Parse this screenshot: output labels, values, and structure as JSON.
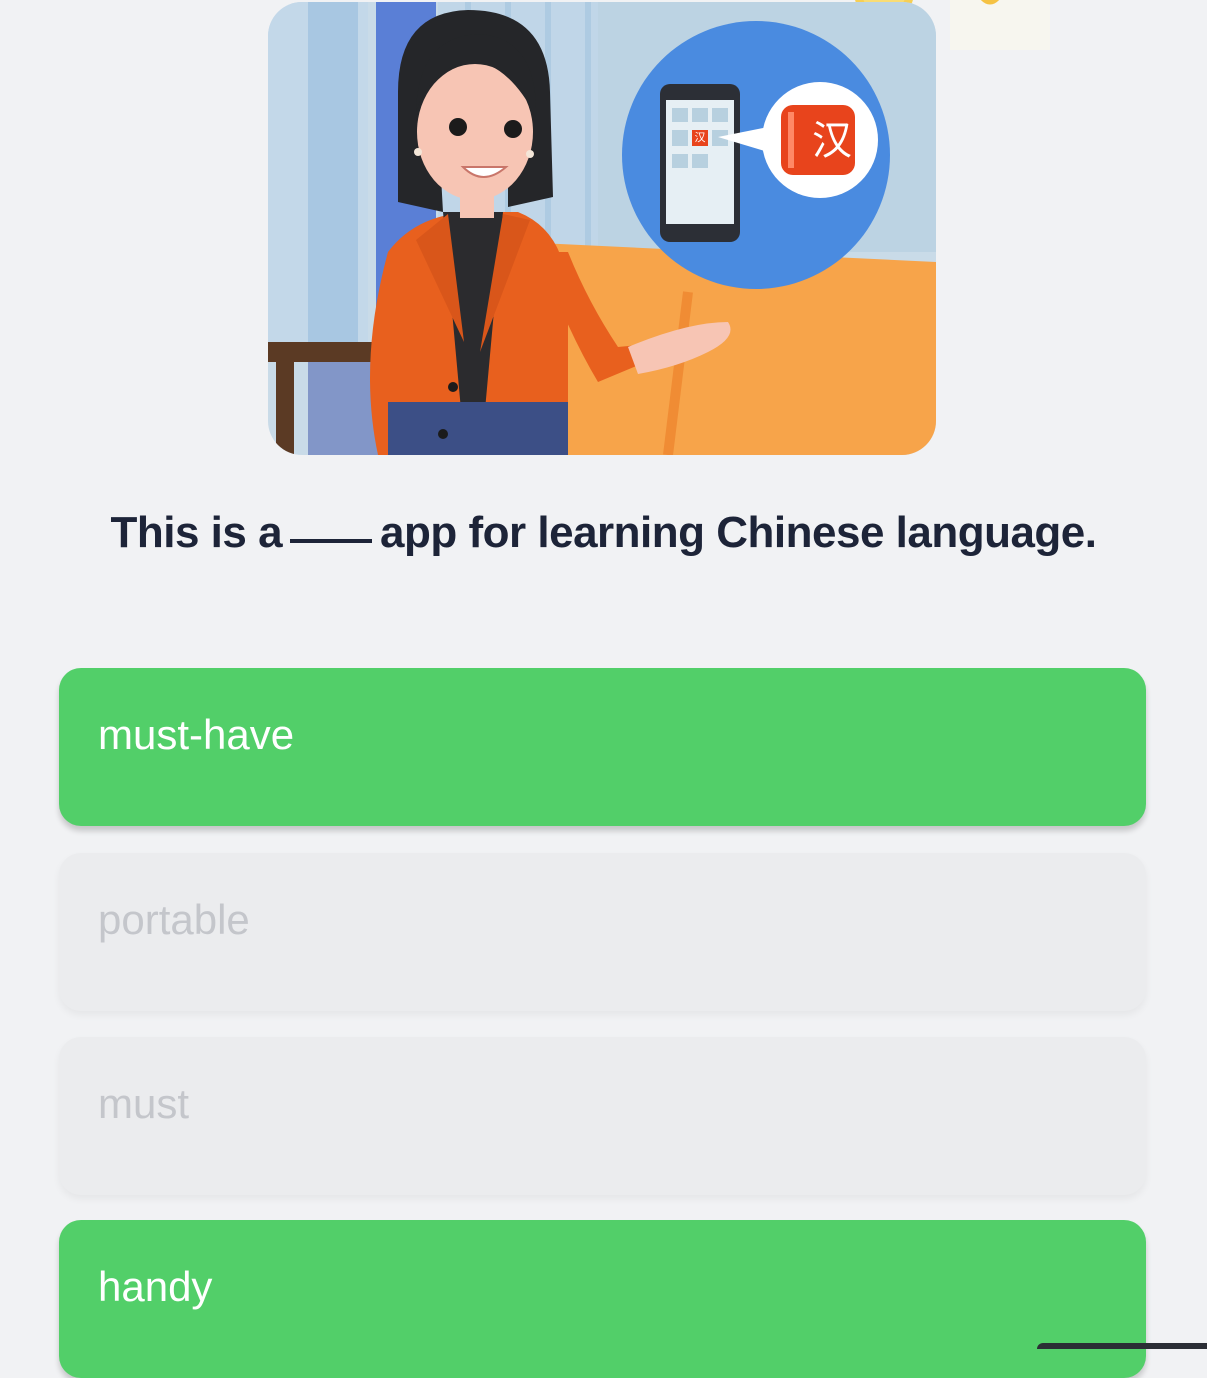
{
  "question": {
    "before": "This is a",
    "after": "app for learning Chinese language."
  },
  "illustration": {
    "glyph": "汉",
    "small_glyph": "汉"
  },
  "options": [
    {
      "label": "must-have",
      "state": "selected"
    },
    {
      "label": "portable",
      "state": "dim"
    },
    {
      "label": "must",
      "state": "dim"
    },
    {
      "label": "handy",
      "state": "selected"
    }
  ],
  "colors": {
    "selected": "#52cf69",
    "dim_bg": "#ebecee",
    "dim_text": "#c4c6cb",
    "question_text": "#1d2438",
    "accent_orange": "#e8601e",
    "accent_blue": "#4a8be0"
  }
}
